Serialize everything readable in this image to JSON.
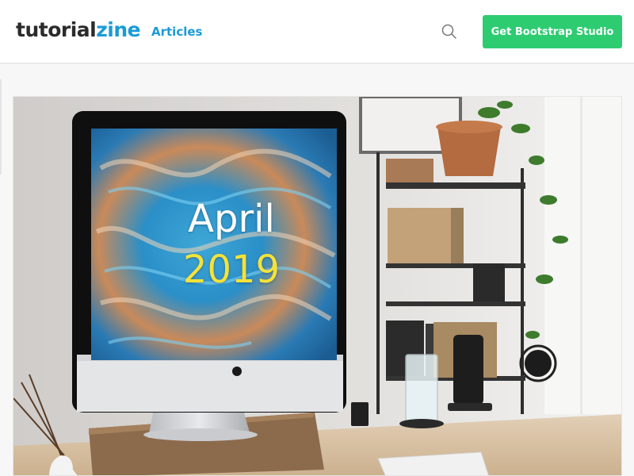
{
  "navbar": {
    "brand_part1": "tutorial",
    "brand_part2": "zine",
    "nav_link_articles": "Articles",
    "search_icon": "search-icon",
    "cta_label": "Get Bootstrap Studio"
  },
  "hero": {
    "month": "April",
    "year": "2019"
  },
  "colors": {
    "brand_blue": "#1a9bd7",
    "cta_green": "#2ecc71",
    "year_yellow": "#f4e23a"
  }
}
